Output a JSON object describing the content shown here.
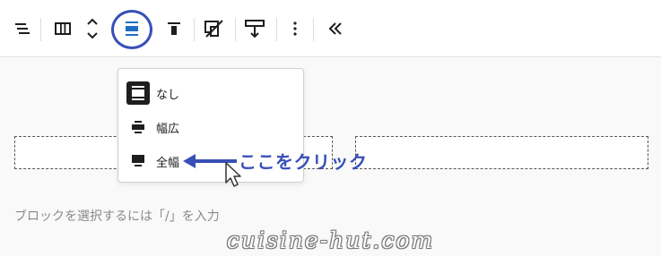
{
  "toolbar": {
    "buttons": [
      {
        "name": "list-view-icon"
      },
      {
        "name": "columns-icon"
      },
      {
        "name": "move-up-down-icon"
      },
      {
        "name": "align-full-icon",
        "active": true
      },
      {
        "name": "align-top-icon"
      },
      {
        "name": "stack-on-mobile-icon"
      },
      {
        "name": "change-height-icon"
      },
      {
        "name": "more-options-icon"
      },
      {
        "name": "collapse-toolbar-icon"
      }
    ]
  },
  "dropdown": {
    "items": [
      {
        "label": "なし",
        "icon": "align-none-icon"
      },
      {
        "label": "幅広",
        "icon": "align-wide-icon"
      },
      {
        "label": "全幅",
        "icon": "align-full-width-icon"
      }
    ]
  },
  "editor": {
    "hint": "ブロックを選択するには「/」を入力"
  },
  "annotation": {
    "text": "ここをクリック",
    "color": "#3850b7"
  },
  "watermark": {
    "text": "cuisine-hut.com"
  }
}
